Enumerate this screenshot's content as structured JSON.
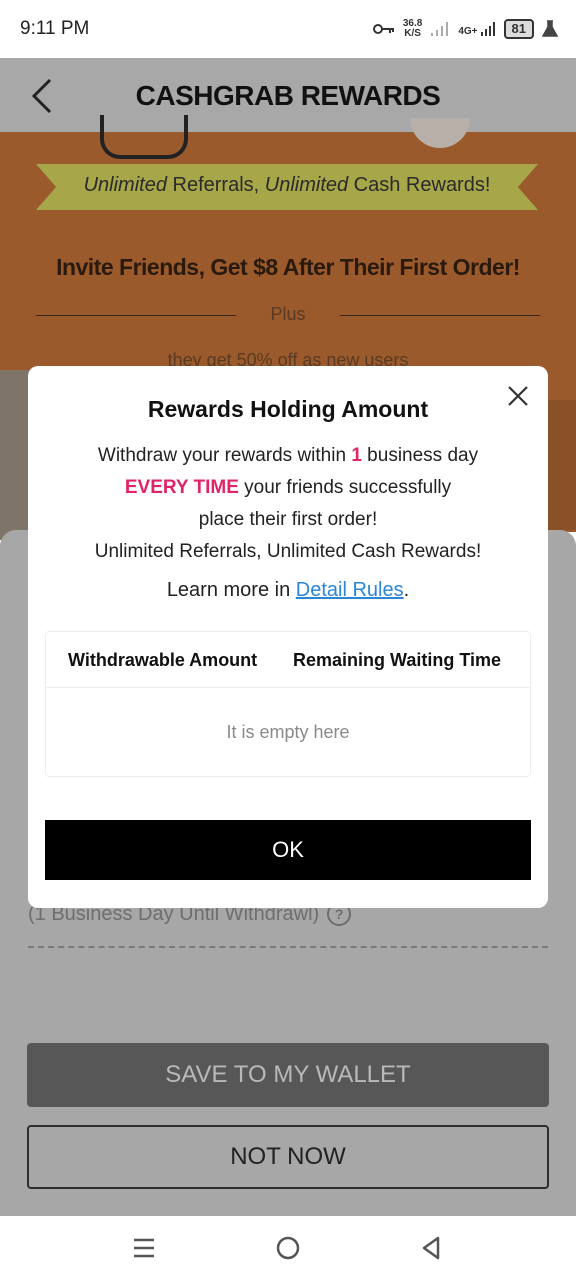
{
  "status_bar": {
    "time": "9:11 PM",
    "net_speed_value": "36.8",
    "net_speed_unit": "K/S",
    "network_type": "4G+",
    "battery": "81"
  },
  "header": {
    "title": "CASHGRAB REWARDS"
  },
  "banner": {
    "ribbon_italic_1": "Unlimited",
    "ribbon_text_1": " Referrals, ",
    "ribbon_italic_2": "Unlimited",
    "ribbon_text_2": " Cash Rewards!",
    "headline": "Invite Friends, Get $8 After Their First Order!",
    "plus": "Plus",
    "subtext": "they get 50% off as new users"
  },
  "sheet": {
    "note": "(1 Business Day Until Withdrawl)",
    "save_label": "SAVE TO MY WALLET",
    "not_now_label": "NOT NOW"
  },
  "modal": {
    "title": "Rewards Holding Amount",
    "line1_prefix": "Withdraw your rewards within ",
    "line1_highlight": "1",
    "line1_suffix": " business day",
    "line2_highlight": "EVERY TIME",
    "line2_suffix": " your friends successfully",
    "line3": "place their first order!",
    "line4": "Unlimited Referrals, Unlimited Cash Rewards!",
    "learn_prefix": "Learn more in ",
    "learn_link": "Detail Rules",
    "learn_suffix": ".",
    "table": {
      "col1": "Withdrawable Amount",
      "col2": "Remaining Waiting Time",
      "empty": "It is empty here"
    },
    "ok_label": "OK"
  },
  "colors": {
    "accent_red": "#e0246a",
    "link_blue": "#2a86d6"
  }
}
